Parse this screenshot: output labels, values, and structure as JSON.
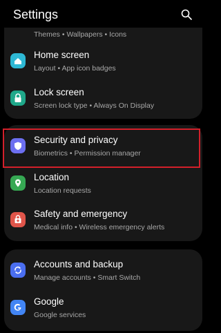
{
  "header": {
    "title": "Settings",
    "search_icon": "search-icon"
  },
  "partial_item": {
    "subtitle": "Themes  •  Wallpapers  •  Icons"
  },
  "items": [
    {
      "title": "Home screen",
      "subtitle": "Layout  •  App icon badges",
      "icon": "home-icon",
      "color": "#2eb8d4"
    },
    {
      "title": "Lock screen",
      "subtitle": "Screen lock type  •  Always On Display",
      "icon": "lock-icon",
      "color": "#1fa88a"
    },
    {
      "title": "Security and privacy",
      "subtitle": "Biometrics  •  Permission manager",
      "icon": "shield-icon",
      "color": "#6c6ff0"
    },
    {
      "title": "Location",
      "subtitle": "Location requests",
      "icon": "location-pin-icon",
      "color": "#36a853"
    },
    {
      "title": "Safety and emergency",
      "subtitle": "Medical info  •  Wireless emergency alerts",
      "icon": "emergency-icon",
      "color": "#e0554a"
    },
    {
      "title": "Accounts and backup",
      "subtitle": "Manage accounts  •  Smart Switch",
      "icon": "sync-icon",
      "color": "#4a6ef0"
    },
    {
      "title": "Google",
      "subtitle": "Google services",
      "icon": "google-icon",
      "color": "#4285f4"
    }
  ],
  "colors": {
    "background": "#000000",
    "card": "#181818",
    "highlight": "#d4202a",
    "subtitle": "#a8a8a8"
  }
}
